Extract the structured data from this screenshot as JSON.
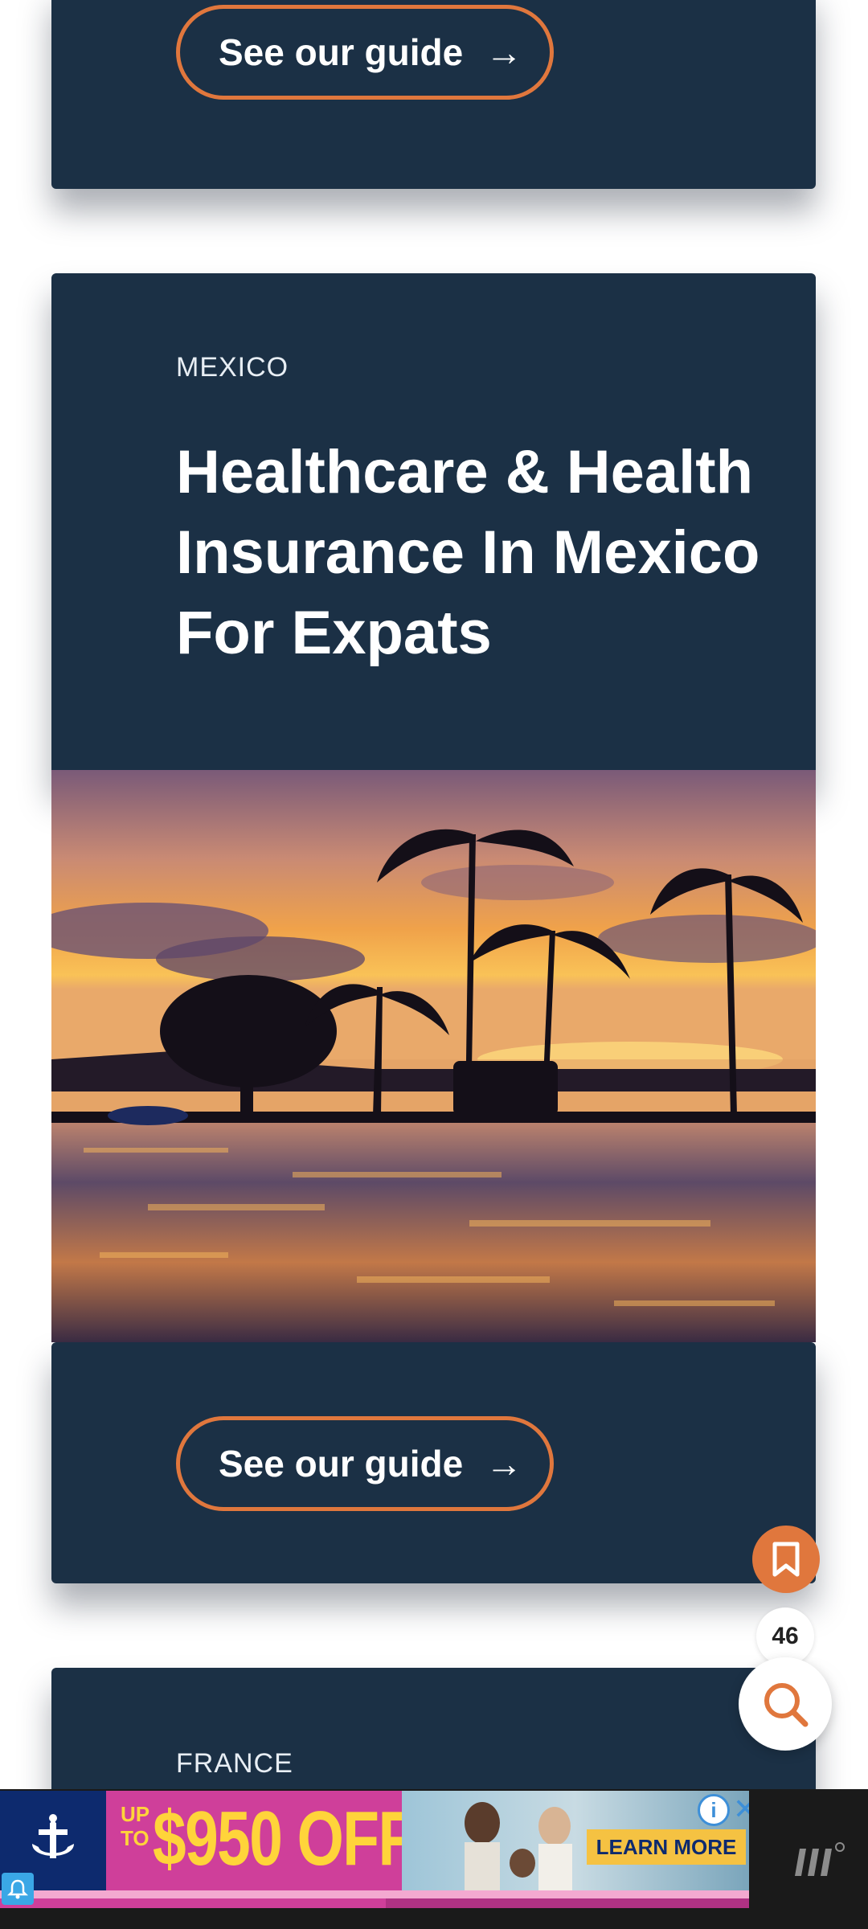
{
  "top_card": {
    "button_label": "See our guide",
    "button_arrow": "→"
  },
  "mexico_card": {
    "kicker": "MEXICO",
    "headline": "Healthcare & Health Insurance In Mexico For Expats",
    "image_icon": "sunset-palm-trees-photo",
    "button_label": "See our guide",
    "button_arrow": "→"
  },
  "france_card": {
    "kicker": "FRANCE"
  },
  "floating": {
    "bookmark_icon": "bookmark-icon",
    "count": "46",
    "search_icon": "search-icon"
  },
  "ad": {
    "up_to": "UP\nTO",
    "price": "$950 OFF",
    "cta": "LEARN MORE",
    "info": "i",
    "close": "✕"
  },
  "colors": {
    "card_bg": "#1b3045",
    "accent": "#e0773d",
    "ad_pink": "#cf3f9a",
    "ad_yellow": "#ffd43a"
  }
}
